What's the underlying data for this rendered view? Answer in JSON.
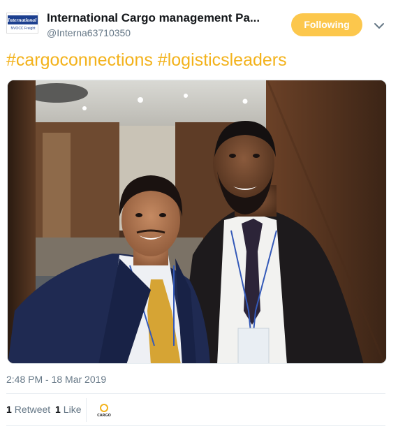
{
  "account": {
    "display_name": "International Cargo management Pa...",
    "handle": "@Interna63710350",
    "avatar_logo_text": "International C",
    "avatar_logo_subtext": "NVOCC Freight"
  },
  "follow_button_label": "Following",
  "tweet": {
    "text": "#cargoconnections #logisticsleaders",
    "timestamp": "2:48 PM - 18 Mar 2019"
  },
  "stats": {
    "retweets_count": "1",
    "retweets_label": "Retweet",
    "likes_count": "1",
    "likes_label": "Like"
  },
  "liker_avatar_text": "CARGO",
  "colors": {
    "accent_yellow": "#f3b21b",
    "follow_button": "#fcc74c",
    "secondary_text": "#657786",
    "divider": "#e6ecf0"
  }
}
